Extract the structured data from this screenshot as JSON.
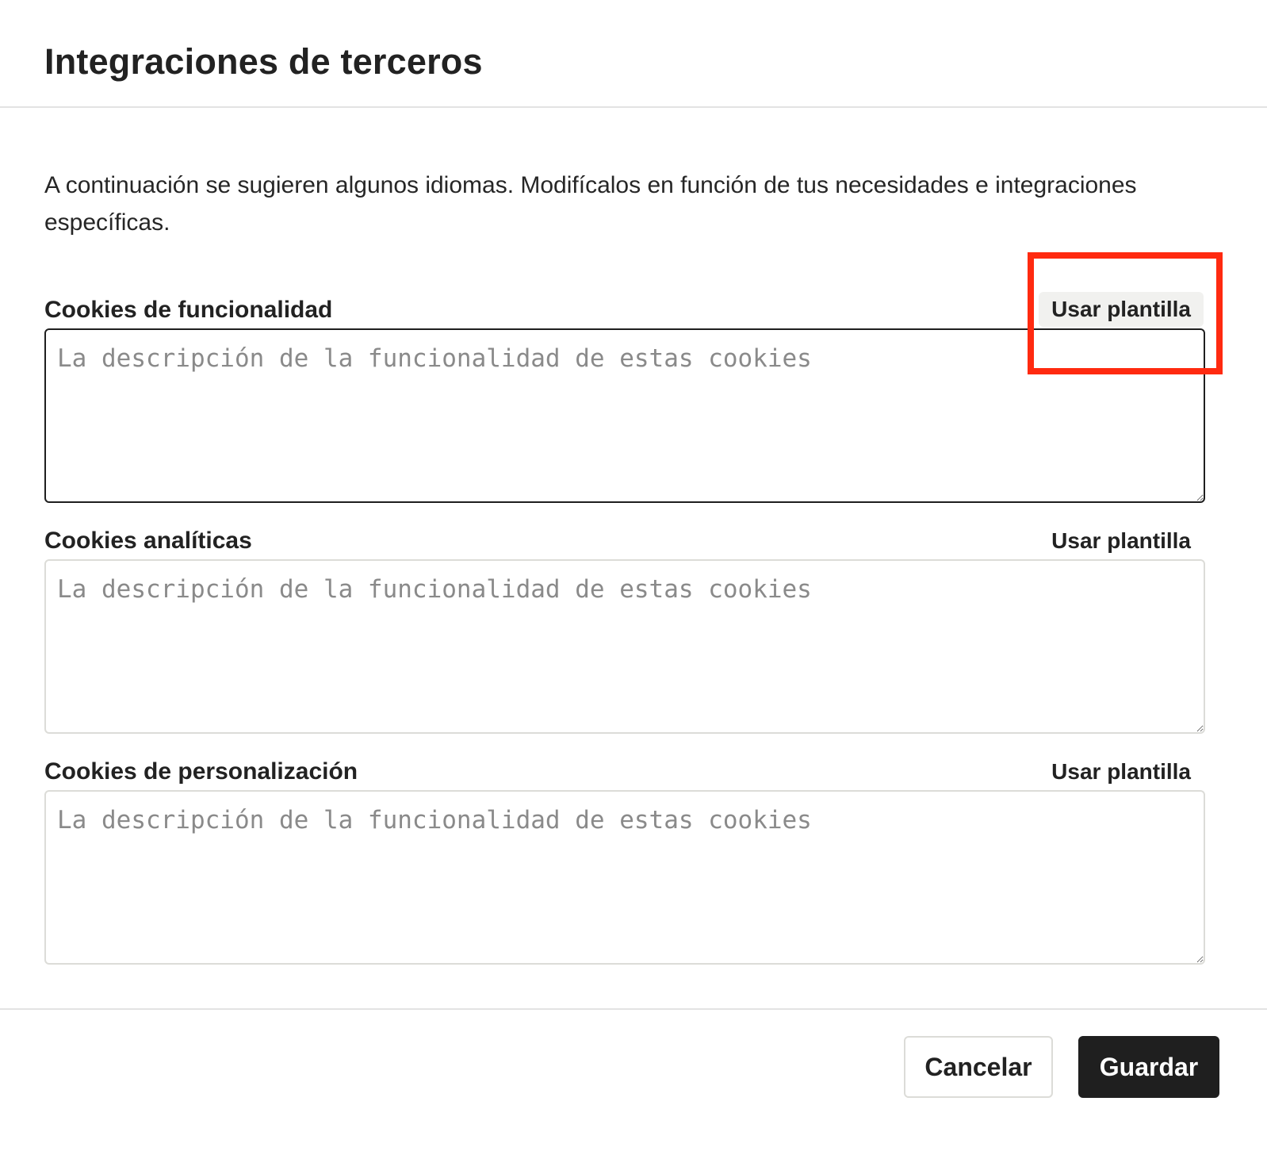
{
  "dialog": {
    "title": "Integraciones de terceros",
    "intro": "A continuación se sugieren algunos idiomas. Modifícalos en función de tus necesidades e integraciones específicas."
  },
  "fields": [
    {
      "label": "Cookies de funcionalidad",
      "template_label": "Usar plantilla",
      "placeholder": "La descripción de la funcionalidad de estas cookies",
      "value": ""
    },
    {
      "label": "Cookies analíticas",
      "template_label": "Usar plantilla",
      "placeholder": "La descripción de la funcionalidad de estas cookies",
      "value": ""
    },
    {
      "label": "Cookies de personalización",
      "template_label": "Usar plantilla",
      "placeholder": "La descripción de la funcionalidad de estas cookies",
      "value": ""
    }
  ],
  "footer": {
    "cancel_label": "Cancelar",
    "save_label": "Guardar"
  },
  "colors": {
    "highlight": "#ff2a10",
    "primary_button": "#1f1f1f"
  }
}
